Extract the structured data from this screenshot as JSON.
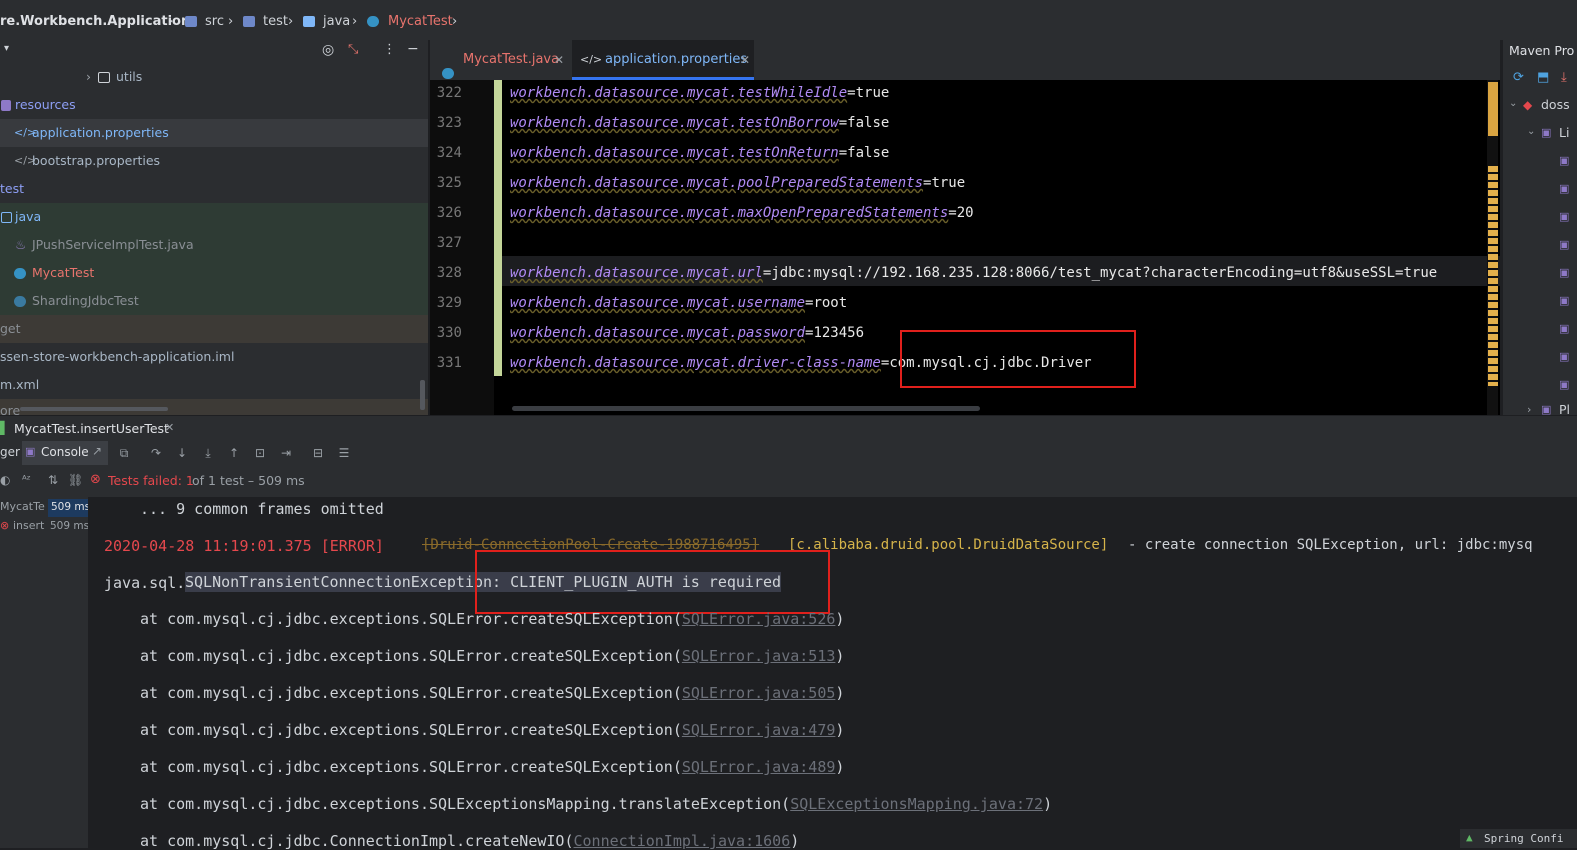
{
  "breadcrumb": {
    "module": "re.Workbench.Application",
    "items": [
      "src",
      "test",
      "java",
      "MycatTest"
    ]
  },
  "project": {
    "rows": [
      {
        "label": "utils",
        "icon": "folder-icon",
        "color": "#a9b7c6"
      },
      {
        "label": "resources",
        "icon": "resources-folder-icon",
        "color": "#8e9ff5"
      },
      {
        "label": "application.properties",
        "icon": "properties-file-icon",
        "color": "#7fb7f8"
      },
      {
        "label": "bootstrap.properties",
        "icon": "properties-file-icon",
        "color": "#a9b7c6"
      },
      {
        "label": "test",
        "icon": "",
        "color": "#8e9ff5"
      },
      {
        "label": "java",
        "icon": "test-folder-icon",
        "color": "#7fb7f8"
      },
      {
        "label": "JPushServiceImplTest.java",
        "icon": "java-file-icon",
        "color": "#8a8f95"
      },
      {
        "label": "MycatTest",
        "icon": "class-icon",
        "color": "#e8746d"
      },
      {
        "label": "ShardingJdbcTest",
        "icon": "class-icon",
        "color": "#8a8f95"
      },
      {
        "label": "get",
        "icon": "",
        "color": "#8a8f95"
      },
      {
        "label": "ssen-store-workbench-application.iml",
        "icon": "",
        "color": "#a9b7c6"
      },
      {
        "label": "m.xml",
        "icon": "",
        "color": "#a9b7c6"
      },
      {
        "label": "ore",
        "icon": "",
        "color": "#8a8f95"
      }
    ]
  },
  "tabs": [
    {
      "label": "MycatTest.java",
      "color": "#e8746d",
      "active": false
    },
    {
      "label": "application.properties",
      "color": "#7fb7f8",
      "active": true
    }
  ],
  "editor": {
    "lines": [
      {
        "num": "322",
        "key": "workbench.datasource.mycat.testWhileIdle",
        "value": "true"
      },
      {
        "num": "323",
        "key": "workbench.datasource.mycat.testOnBorrow",
        "value": "false"
      },
      {
        "num": "324",
        "key": "workbench.datasource.mycat.testOnReturn",
        "value": "false"
      },
      {
        "num": "325",
        "key": "workbench.datasource.mycat.poolPreparedStatements",
        "value": "true"
      },
      {
        "num": "326",
        "key": "workbench.datasource.mycat.maxOpenPreparedStatements",
        "value": "20"
      },
      {
        "num": "327",
        "key": "",
        "value": ""
      },
      {
        "num": "328",
        "key": "workbench.datasource.mycat.url",
        "value": "jdbc:mysql://192.168.235.128:8066/test_mycat?characterEncoding=utf8&useSSL=true"
      },
      {
        "num": "329",
        "key": "workbench.datasource.mycat.username",
        "value": "root"
      },
      {
        "num": "330",
        "key": "workbench.datasource.mycat.password",
        "value": "123456"
      },
      {
        "num": "331",
        "key": "workbench.datasource.mycat.driver-class-name",
        "value": "com.mysql.cj.jdbc.Driver"
      }
    ]
  },
  "maven": {
    "title": "Maven Pro",
    "items": [
      "doss",
      "Li",
      "Pl"
    ]
  },
  "run": {
    "tab_label": "MycatTest.insertUserTest",
    "left_cut": "ger",
    "console_label": "Console",
    "status_text": "Tests failed: 1",
    "status_suffix": "of 1 test – 509 ms",
    "tree": [
      {
        "label": "MycatTe",
        "time": "509 ms"
      },
      {
        "label": "insert",
        "time": "509 ms"
      }
    ]
  },
  "console": {
    "omitted": "... 9 common frames omitted",
    "error_ts": "2020-04-28 11:19:01.375 [ERROR]",
    "error_thread": "[Druid-ConnectionPool-Create-1988716495]",
    "error_logger": "[c.alibaba.druid.pool.DruidDataSource]",
    "error_msg": "- create connection SQLException, url: jdbc:mysq",
    "exc_prefix": "java.sql.",
    "exc_name": "SQLNonTransientConnectionException: CLIENT_PLUGIN_AUTH is required",
    "frames": [
      {
        "text": "at com.mysql.cj.jdbc.exceptions.SQLError.createSQLException(",
        "link": "SQLError.java:526",
        "end": ")"
      },
      {
        "text": "at com.mysql.cj.jdbc.exceptions.SQLError.createSQLException(",
        "link": "SQLError.java:513",
        "end": ")"
      },
      {
        "text": "at com.mysql.cj.jdbc.exceptions.SQLError.createSQLException(",
        "link": "SQLError.java:505",
        "end": ")"
      },
      {
        "text": "at com.mysql.cj.jdbc.exceptions.SQLError.createSQLException(",
        "link": "SQLError.java:479",
        "end": ")"
      },
      {
        "text": "at com.mysql.cj.jdbc.exceptions.SQLError.createSQLException(",
        "link": "SQLError.java:489",
        "end": ")"
      },
      {
        "text": "at com.mysql.cj.jdbc.exceptions.SQLExceptionsMapping.translateException(",
        "link": "SQLExceptionsMapping.java:72",
        "end": ")"
      },
      {
        "text": "at com.mysql.cj.jdbc.ConnectionImpl.createNewIO(",
        "link": "ConnectionImpl.java:1606",
        "end": ")"
      }
    ],
    "corner_label": "Spring Confi"
  }
}
